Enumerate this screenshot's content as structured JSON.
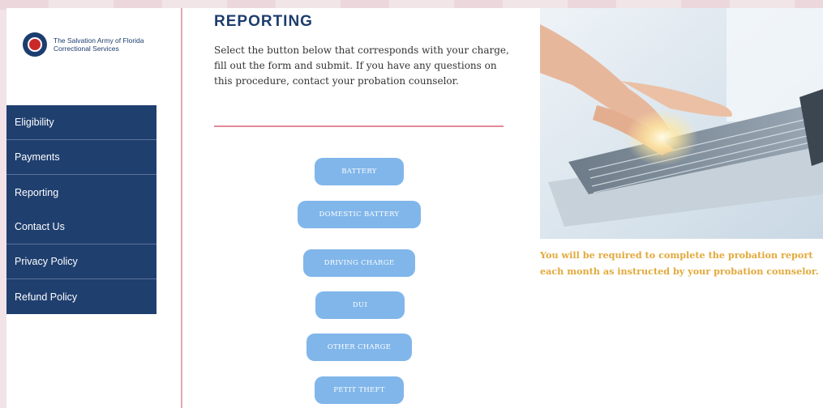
{
  "sidebar": {
    "logo_text": "The Salvation Army of Florida Correctional Services",
    "items": [
      {
        "label": "Eligibility"
      },
      {
        "label": "Payments"
      },
      {
        "label": "Reporting"
      },
      {
        "label": "Contact Us"
      },
      {
        "label": "Privacy Policy"
      },
      {
        "label": "Refund Policy"
      }
    ]
  },
  "main": {
    "title": "REPORTING",
    "intro": "Select the button below that corresponds with your charge, fill out the form and submit. If you have any questions on this procedure, contact your probation counselor.",
    "buttons": [
      {
        "label": "BATTERY"
      },
      {
        "label": "DOMESTIC BATTERY"
      },
      {
        "label": "DRIVING CHARGE"
      },
      {
        "label": "DUI"
      },
      {
        "label": "OTHER CHARGE"
      },
      {
        "label": "PETIT THEFT"
      }
    ]
  },
  "aside": {
    "note": "You will be required to complete the probation report each month as instructed by your probation counselor."
  },
  "colors": {
    "nav_bg": "#1f3f6f",
    "button_bg": "#80b6ea",
    "accent_line": "#e08a98",
    "note_text": "#e2a93b",
    "title_text": "#1d3d6e"
  }
}
